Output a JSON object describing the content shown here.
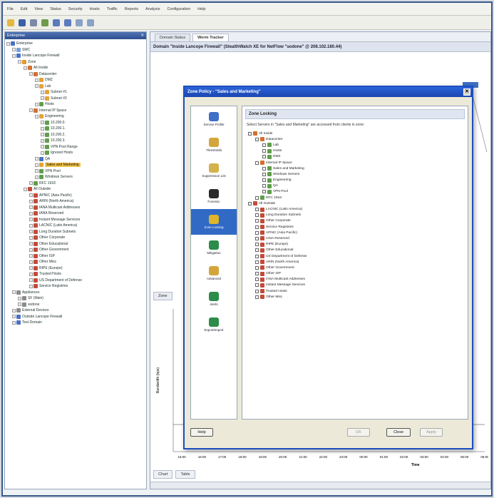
{
  "menubar": [
    "File",
    "Edit",
    "View",
    "Status",
    "Security",
    "Hosts",
    "Traffic",
    "Reports",
    "Analysis",
    "Configuration",
    "Help"
  ],
  "left_panel": {
    "title": "Enterprise",
    "items": [
      {
        "label": "Enterprise",
        "depth": 0,
        "icon": "enterprise-icon",
        "color": "#4a72c4",
        "sel": false
      },
      {
        "label": "SMC",
        "depth": 1,
        "icon": "smc-icon",
        "color": "#7aa0d8",
        "sel": false
      },
      {
        "label": "Inside Lancope Firewall",
        "depth": 1,
        "icon": "firewall-icon",
        "color": "#4a72c4",
        "sel": false
      },
      {
        "label": "Zone",
        "depth": 2,
        "icon": "zone-icon",
        "color": "#e59a2c",
        "sel": false
      },
      {
        "label": "All Inside",
        "depth": 3,
        "icon": "host-group-icon",
        "color": "#d66f2e",
        "sel": false
      },
      {
        "label": "Datacenter",
        "depth": 4,
        "icon": "host-group-icon",
        "color": "#d66f2e",
        "sel": false
      },
      {
        "label": "DMZ",
        "depth": 5,
        "icon": "host-group-icon",
        "color": "#e5a23a",
        "sel": false
      },
      {
        "label": "Lab",
        "depth": 5,
        "icon": "host-group-icon",
        "color": "#e5a23a",
        "sel": false
      },
      {
        "label": "Subnet #1",
        "depth": 6,
        "icon": "host-group-icon",
        "color": "#e5a23a",
        "sel": false
      },
      {
        "label": "Subnet #2",
        "depth": 6,
        "icon": "host-group-icon",
        "color": "#e5a23a",
        "sel": false
      },
      {
        "label": "Hosts",
        "depth": 5,
        "icon": "host-icon",
        "color": "#5f9e4a",
        "sel": false
      },
      {
        "label": "Internal IP Space",
        "depth": 4,
        "icon": "host-group-icon",
        "color": "#d66f2e",
        "sel": false
      },
      {
        "label": "Engineering",
        "depth": 5,
        "icon": "host-group-icon",
        "color": "#e5a23a",
        "sel": false
      },
      {
        "label": "10.200.0.",
        "depth": 6,
        "icon": "host-icon",
        "color": "#5f9e4a",
        "sel": false
      },
      {
        "label": "10.200.1.",
        "depth": 6,
        "icon": "host-icon",
        "color": "#5f9e4a",
        "sel": false
      },
      {
        "label": "10.200.2.",
        "depth": 6,
        "icon": "host-icon",
        "color": "#5f9e4a",
        "sel": false
      },
      {
        "label": "10.200.3.",
        "depth": 6,
        "icon": "host-icon",
        "color": "#5f9e4a",
        "sel": false
      },
      {
        "label": "VPN Pool Range",
        "depth": 6,
        "icon": "host-icon",
        "color": "#5f9e4a",
        "sel": false
      },
      {
        "label": "Ignored Hosts",
        "depth": 6,
        "icon": "host-icon",
        "color": "#5f9e4a",
        "sel": false
      },
      {
        "label": "QA",
        "depth": 5,
        "icon": "host-icon",
        "color": "#4a72c4",
        "sel": false
      },
      {
        "label": "Sales and Marketing",
        "depth": 5,
        "icon": "host-group-icon",
        "color": "#e5a23a",
        "sel": true
      },
      {
        "label": "VPN Pool",
        "depth": 5,
        "icon": "host-icon",
        "color": "#5f9e4a",
        "sel": false
      },
      {
        "label": "Windows Servers",
        "depth": 5,
        "icon": "host-icon",
        "color": "#5f9e4a",
        "sel": false
      },
      {
        "label": "RFC 1918",
        "depth": 4,
        "icon": "host-icon",
        "color": "#5f9e4a",
        "sel": false
      },
      {
        "label": "All Outside",
        "depth": 3,
        "icon": "outside-icon",
        "color": "#c44a3a",
        "sel": false
      },
      {
        "label": "APNIC (Asia Pacific)",
        "depth": 4,
        "icon": "host-group-icon",
        "color": "#c44a3a",
        "sel": false
      },
      {
        "label": "ARIN (North America)",
        "depth": 4,
        "icon": "host-group-icon",
        "color": "#c44a3a",
        "sel": false
      },
      {
        "label": "IANA Multicast Addresses",
        "depth": 4,
        "icon": "host-group-icon",
        "color": "#c44a3a",
        "sel": false
      },
      {
        "label": "IANA Reserved",
        "depth": 4,
        "icon": "host-group-icon",
        "color": "#c44a3a",
        "sel": false
      },
      {
        "label": "Instant Message Services",
        "depth": 4,
        "icon": "host-group-icon",
        "color": "#c44a3a",
        "sel": false
      },
      {
        "label": "LACNIC (Latin America)",
        "depth": 4,
        "icon": "host-group-icon",
        "color": "#c44a3a",
        "sel": false
      },
      {
        "label": "Long Duration Subnets",
        "depth": 4,
        "icon": "host-group-icon",
        "color": "#c44a3a",
        "sel": false
      },
      {
        "label": "Other Corporate",
        "depth": 4,
        "icon": "host-group-icon",
        "color": "#c44a3a",
        "sel": false
      },
      {
        "label": "Other Educational",
        "depth": 4,
        "icon": "host-group-icon",
        "color": "#c44a3a",
        "sel": false
      },
      {
        "label": "Other Government",
        "depth": 4,
        "icon": "host-group-icon",
        "color": "#c44a3a",
        "sel": false
      },
      {
        "label": "Other ISP",
        "depth": 4,
        "icon": "host-group-icon",
        "color": "#c44a3a",
        "sel": false
      },
      {
        "label": "Other Misc",
        "depth": 4,
        "icon": "host-group-icon",
        "color": "#c44a3a",
        "sel": false
      },
      {
        "label": "RIPE (Europe)",
        "depth": 4,
        "icon": "host-group-icon",
        "color": "#c44a3a",
        "sel": false
      },
      {
        "label": "Trusted Hosts",
        "depth": 4,
        "icon": "host-group-icon",
        "color": "#c44a3a",
        "sel": false
      },
      {
        "label": "US Department of Defense",
        "depth": 4,
        "icon": "host-group-icon",
        "color": "#c44a3a",
        "sel": false
      },
      {
        "label": "Service Registries",
        "depth": 4,
        "icon": "host-group-icon",
        "color": "#c44a3a",
        "sel": false
      },
      {
        "label": "Appliances",
        "depth": 1,
        "icon": "appliance-icon",
        "color": "#8a8a8a",
        "sel": false
      },
      {
        "label": "SF (Main)",
        "depth": 2,
        "icon": "appliance-icon",
        "color": "#8a8a8a",
        "sel": false
      },
      {
        "label": "sodone",
        "depth": 2,
        "icon": "appliance-icon",
        "color": "#8a8a8a",
        "sel": false
      },
      {
        "label": "External Devices",
        "depth": 1,
        "icon": "device-icon",
        "color": "#8a8a8a",
        "sel": false
      },
      {
        "label": "Outside Lancope Firewall",
        "depth": 1,
        "icon": "firewall-icon",
        "color": "#4a72c4",
        "sel": false
      },
      {
        "label": "Test Domain",
        "depth": 1,
        "icon": "domain-icon",
        "color": "#4a72c4",
        "sel": false
      }
    ]
  },
  "main": {
    "tabs": [
      "Domain Status",
      "Worm Tracker"
    ],
    "domain_bar": "Domain \"Inside Lancope Firewall\" (StealthWatch XE for NetFlow \"sodone\" @ 208.102.180.44)",
    "chart_tab": "Zone",
    "bottom_tabs": [
      "Chart",
      "Table"
    ],
    "ylabel": "Bandwidth (bps)",
    "xlabel": "Time",
    "xticks": [
      "15:00",
      "16:00",
      "17:00",
      "18:00",
      "19:00",
      "20:00",
      "21:00",
      "22:00",
      "23:00",
      "00:00",
      "01:00",
      "02:00",
      "03:00",
      "04:00",
      "05:00",
      "06:00"
    ]
  },
  "dialog": {
    "title": "Zone Policy - \"Sales and Marketing\"",
    "section": "Zone Locking",
    "description": "Select Servers in \"Sales and Marketing\" are accessed from clients in zone:",
    "nav": [
      {
        "label": "Service Profile",
        "icon": "service-profile-icon",
        "color": "#3f6fc6"
      },
      {
        "label": "Thresholds",
        "icon": "thresholds-icon",
        "color": "#d4a53a"
      },
      {
        "label": "Suppression List",
        "icon": "suppression-icon",
        "color": "#d4b14a"
      },
      {
        "label": "Forensic",
        "icon": "forensic-icon",
        "color": "#2b2b2b"
      },
      {
        "label": "Zone Locking",
        "icon": "zone-lock-icon",
        "color": "#e0b52a"
      },
      {
        "label": "Mitigation",
        "icon": "mitigation-icon",
        "color": "#2c8c4a"
      },
      {
        "label": "Advanced",
        "icon": "advanced-icon",
        "color": "#d4a53a"
      },
      {
        "label": "Alerts",
        "icon": "alerts-icon",
        "color": "#2c8c4a"
      },
      {
        "label": "Export/Import",
        "icon": "export-icon",
        "color": "#2c8c4a"
      }
    ],
    "active_nav": 4,
    "tree": [
      {
        "label": "All Inside",
        "depth": 0,
        "color": "#d66f2e"
      },
      {
        "label": "Datacenter",
        "depth": 1,
        "color": "#d66f2e"
      },
      {
        "label": "Lab",
        "depth": 2,
        "color": "#5f9e4a"
      },
      {
        "label": "Hosts",
        "depth": 2,
        "color": "#5f9e4a"
      },
      {
        "label": "DMZ",
        "depth": 2,
        "color": "#5f9e4a"
      },
      {
        "label": "Internal IP Space",
        "depth": 1,
        "color": "#d66f2e"
      },
      {
        "label": "Sales and Marketing",
        "depth": 2,
        "color": "#5f9e4a"
      },
      {
        "label": "Windows Servers",
        "depth": 2,
        "color": "#5f9e4a"
      },
      {
        "label": "Engineering",
        "depth": 2,
        "color": "#5f9e4a"
      },
      {
        "label": "QA",
        "depth": 2,
        "color": "#5f9e4a"
      },
      {
        "label": "VPN Pool",
        "depth": 2,
        "color": "#5f9e4a"
      },
      {
        "label": "RFC 1918",
        "depth": 1,
        "color": "#5f9e4a"
      },
      {
        "label": "All Outside",
        "depth": 0,
        "color": "#c44a3a"
      },
      {
        "label": "LACNIC (Latin America)",
        "depth": 1,
        "color": "#c44a3a"
      },
      {
        "label": "Long Duration Subnets",
        "depth": 1,
        "color": "#c44a3a"
      },
      {
        "label": "Other Corporate",
        "depth": 1,
        "color": "#c44a3a"
      },
      {
        "label": "Service Registries",
        "depth": 1,
        "color": "#c44a3a"
      },
      {
        "label": "APNIC (Asia Pacific)",
        "depth": 1,
        "color": "#c44a3a"
      },
      {
        "label": "IANA Reserved",
        "depth": 1,
        "color": "#c44a3a"
      },
      {
        "label": "RIPE (Europe)",
        "depth": 1,
        "color": "#c44a3a"
      },
      {
        "label": "Other Educational",
        "depth": 1,
        "color": "#c44a3a"
      },
      {
        "label": "US Department of Defense",
        "depth": 1,
        "color": "#c44a3a"
      },
      {
        "label": "ARIN (North America)",
        "depth": 1,
        "color": "#c44a3a"
      },
      {
        "label": "Other Government",
        "depth": 1,
        "color": "#c44a3a"
      },
      {
        "label": "Other ISP",
        "depth": 1,
        "color": "#c44a3a"
      },
      {
        "label": "IANA Multicast Addresses",
        "depth": 1,
        "color": "#c44a3a"
      },
      {
        "label": "Instant Message Services",
        "depth": 1,
        "color": "#c44a3a"
      },
      {
        "label": "Trusted Hosts",
        "depth": 1,
        "color": "#c44a3a"
      },
      {
        "label": "Other Misc",
        "depth": 1,
        "color": "#c44a3a"
      }
    ],
    "buttons": {
      "help": "Help",
      "ok": "OK",
      "close": "Close",
      "apply": "Apply"
    }
  }
}
